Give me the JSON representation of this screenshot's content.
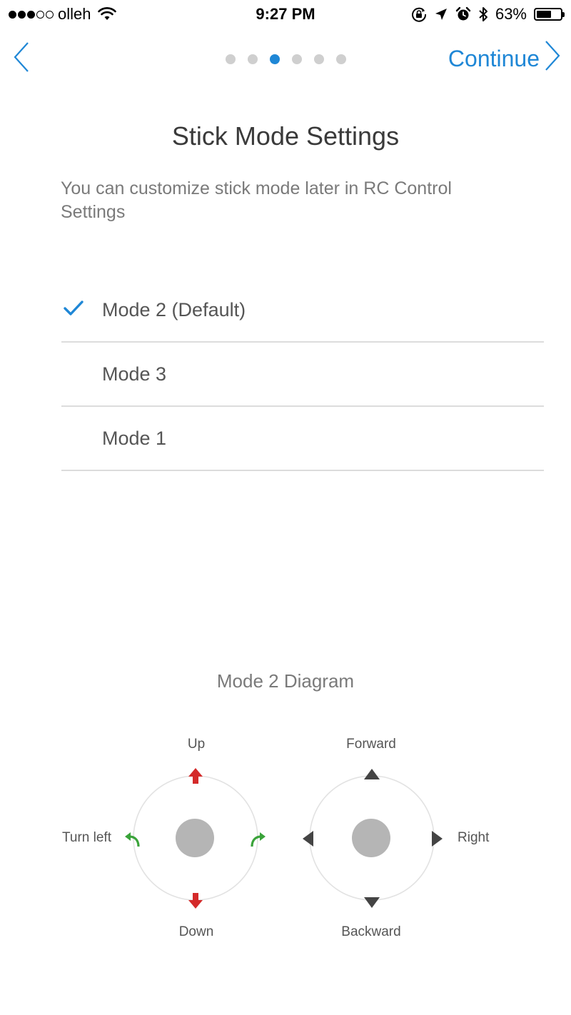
{
  "status_bar": {
    "carrier": "olleh",
    "time": "9:27 PM",
    "battery_percent": "63%",
    "battery_level": 0.63,
    "signal_bars_filled": 3,
    "signal_bars_total": 5,
    "icons": [
      "wifi-icon",
      "orientation-lock-icon",
      "location-arrow-icon",
      "alarm-icon",
      "bluetooth-icon",
      "battery-icon"
    ]
  },
  "nav": {
    "back_icon": "chevron-left-icon",
    "continue_label": "Continue",
    "continue_icon": "chevron-right-icon",
    "page_count": 6,
    "active_page": 3,
    "accent_color": "#1f87d6"
  },
  "main": {
    "title": "Stick Mode Settings",
    "subtitle": "You can customize stick mode later in RC Control Settings",
    "modes": [
      {
        "label": "Mode 2 (Default)",
        "selected": true
      },
      {
        "label": "Mode 3",
        "selected": false
      },
      {
        "label": "Mode 1",
        "selected": false
      }
    ]
  },
  "diagram": {
    "title": "Mode 2 Diagram",
    "left_stick": {
      "up": "Up",
      "down": "Down",
      "left": "Turn left",
      "arrow_colors": {
        "vertical": "#d42a2a",
        "rotate": "#3aa33a"
      }
    },
    "right_stick": {
      "up": "Forward",
      "down": "Backward",
      "right": "Right",
      "arrow_color": "#444444"
    }
  }
}
